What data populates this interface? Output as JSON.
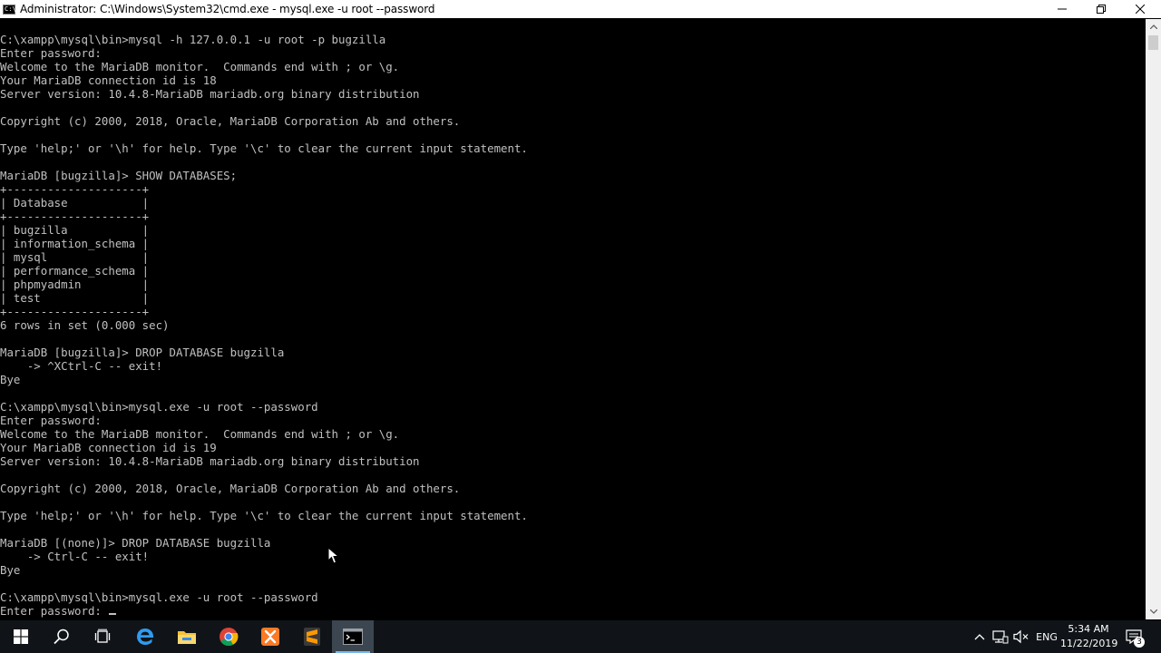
{
  "window": {
    "title": "Administrator: C:\\Windows\\System32\\cmd.exe - mysql.exe  -u root --password",
    "icon_label": "C:\\",
    "controls": [
      "minimize-icon",
      "restore-icon",
      "close-icon"
    ]
  },
  "console": {
    "lines": [
      "C:\\xampp\\mysql\\bin>mysql -h 127.0.0.1 -u root -p bugzilla",
      "Enter password:",
      "Welcome to the MariaDB monitor.  Commands end with ; or \\g.",
      "Your MariaDB connection id is 18",
      "Server version: 10.4.8-MariaDB mariadb.org binary distribution",
      "",
      "Copyright (c) 2000, 2018, Oracle, MariaDB Corporation Ab and others.",
      "",
      "Type 'help;' or '\\h' for help. Type '\\c' to clear the current input statement.",
      "",
      "MariaDB [bugzilla]> SHOW DATABASES;",
      "+--------------------+",
      "| Database           |",
      "+--------------------+",
      "| bugzilla           |",
      "| information_schema |",
      "| mysql              |",
      "| performance_schema |",
      "| phpmyadmin         |",
      "| test               |",
      "+--------------------+",
      "6 rows in set (0.000 sec)",
      "",
      "MariaDB [bugzilla]> DROP DATABASE bugzilla",
      "    -> ^XCtrl-C -- exit!",
      "Bye",
      "",
      "C:\\xampp\\mysql\\bin>mysql.exe -u root --password",
      "Enter password:",
      "Welcome to the MariaDB monitor.  Commands end with ; or \\g.",
      "Your MariaDB connection id is 19",
      "Server version: 10.4.8-MariaDB mariadb.org binary distribution",
      "",
      "Copyright (c) 2000, 2018, Oracle, MariaDB Corporation Ab and others.",
      "",
      "Type 'help;' or '\\h' for help. Type '\\c' to clear the current input statement.",
      "",
      "MariaDB [(none)]> DROP DATABASE bugzilla",
      "    -> Ctrl-C -- exit!",
      "Bye",
      "",
      "C:\\xampp\\mysql\\bin>mysql.exe -u root --password"
    ],
    "prompt_line": "Enter password: "
  },
  "taskbar": {
    "apps": [
      "start-icon",
      "search-icon",
      "task-view-icon",
      "edge-icon",
      "file-explorer-icon",
      "chrome-icon",
      "xampp-icon",
      "sublime-text-icon",
      "cmd-icon"
    ],
    "active_app": "cmd-icon",
    "tray": {
      "icons": [
        "chevron-up-icon",
        "network-icon",
        "volume-muted-icon"
      ],
      "language": "ENG",
      "time": "5:34 AM",
      "date": "11/22/2019",
      "notification_count": "3"
    }
  },
  "colors": {
    "console_text": "#c0c0c0",
    "console_bg": "#000000",
    "taskbar_bg": "#101418",
    "accent": "#76b9ed"
  }
}
